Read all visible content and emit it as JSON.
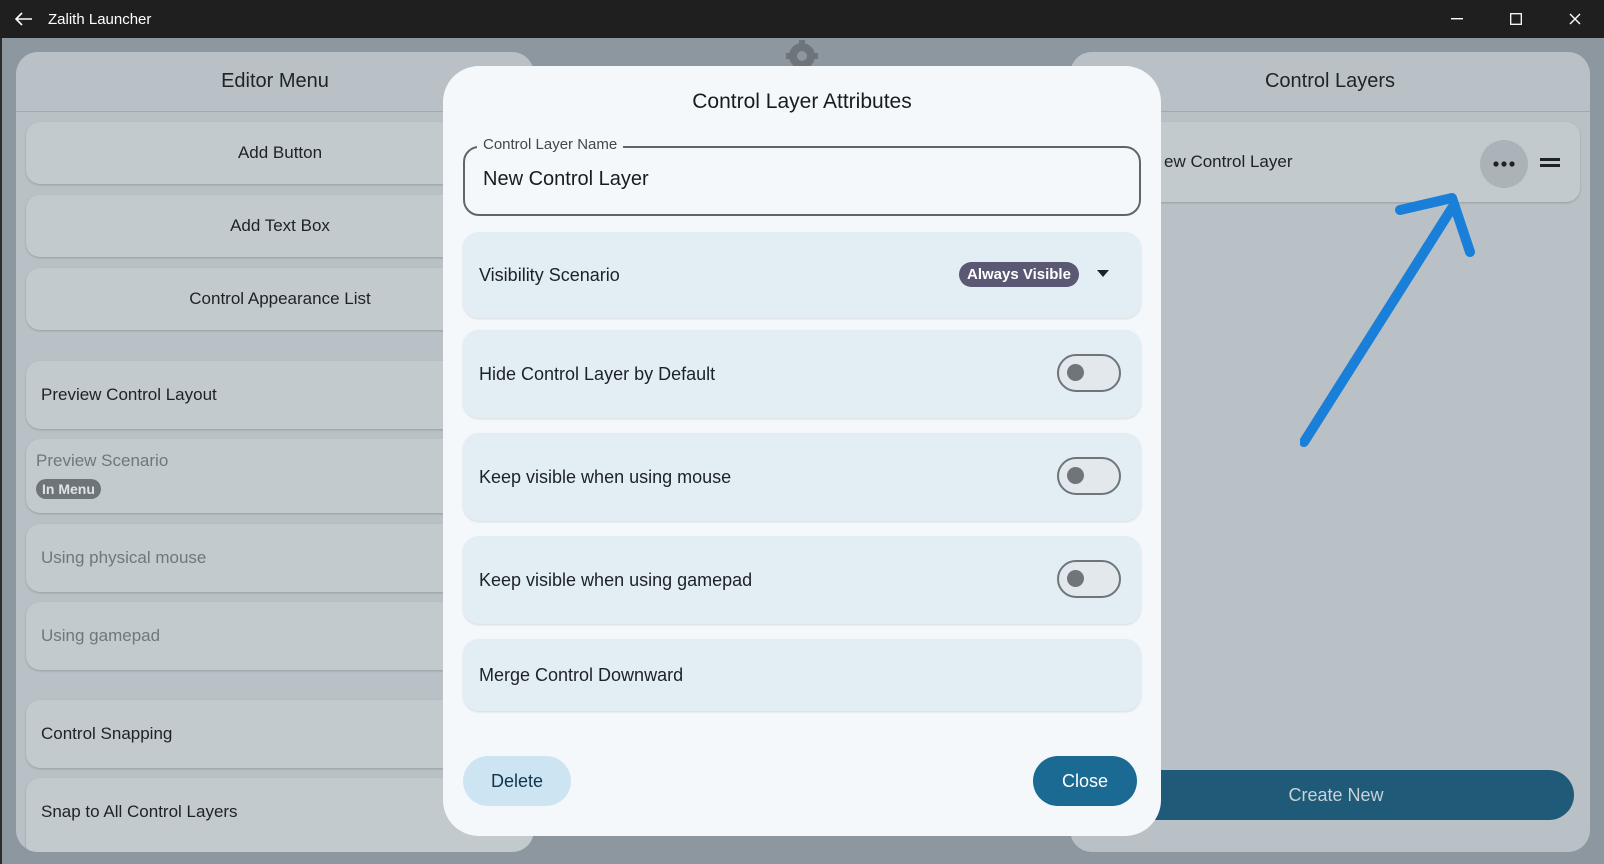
{
  "window": {
    "title": "Zalith Launcher"
  },
  "editor_menu": {
    "title": "Editor Menu",
    "add_button": "Add Button",
    "add_text_box": "Add Text Box",
    "control_appearance_list": "Control Appearance List",
    "preview_control_layout": "Preview Control Layout",
    "preview_scenario": "Preview Scenario",
    "preview_scenario_value": "In Menu",
    "using_physical_mouse": "Using physical mouse",
    "using_gamepad": "Using gamepad",
    "control_snapping": "Control Snapping",
    "snap_to_all_layers": "Snap to All Control Layers"
  },
  "control_layers": {
    "title": "Control Layers",
    "items": [
      {
        "label": "ew Control Layer"
      }
    ],
    "create_new": "Create New"
  },
  "dialog": {
    "title": "Control Layer Attributes",
    "name_field_label": "Control Layer Name",
    "name_field_value": "New Control Layer",
    "visibility_label": "Visibility Scenario",
    "visibility_value": "Always Visible",
    "hide_by_default_label": "Hide Control Layer by Default",
    "hide_by_default_on": false,
    "keep_visible_mouse_label": "Keep visible when using mouse",
    "keep_visible_mouse_on": false,
    "keep_visible_gamepad_label": "Keep visible when using gamepad",
    "keep_visible_gamepad_on": false,
    "merge_label": "Merge Control Downward",
    "delete_label": "Delete",
    "close_label": "Close"
  },
  "colors": {
    "accent": "#1b6a94",
    "chip": "#5b5874",
    "annotation_arrow": "#1a7fd8"
  },
  "icons": [
    "back-arrow-icon",
    "minimize-icon",
    "maximize-icon",
    "close-icon",
    "gear-icon",
    "more-horizontal-icon",
    "drag-handle-icon",
    "chevron-down-icon"
  ]
}
